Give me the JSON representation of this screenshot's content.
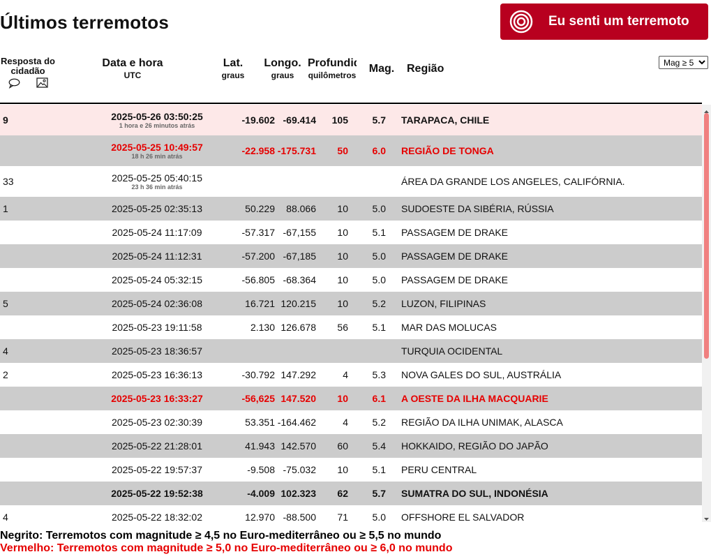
{
  "page": {
    "title": "Últimos terremotos"
  },
  "felt_button": {
    "label": "Eu senti um terremoto",
    "icon": "target-icon"
  },
  "header": {
    "response": "Resposta do cidadão",
    "date": "Data e hora",
    "date_sub": "UTC",
    "lat": "Lat.",
    "lat_sub": "graus",
    "lon": "Longo.",
    "lon_sub": "graus",
    "depth": "Profundid",
    "depth_sub": "quilômetros",
    "mag": "Mag.",
    "region": "Região"
  },
  "filter": {
    "selected": "Mag ≥ 5"
  },
  "rows": [
    {
      "resp": "9",
      "date": "2025-05-26 03:50:25",
      "ago": "1 hora e 26 minutos atrás",
      "lat": "-19.602",
      "lon": "-69.414",
      "depth": "105",
      "mag": "5.7",
      "region": "TARAPACA, CHILE",
      "style": "hl bold"
    },
    {
      "resp": "",
      "date": "2025-05-25 10:49:57",
      "ago": "18 h 26 min atrás",
      "lat": "-22.958",
      "lon": "-175.731",
      "depth": "50",
      "mag": "6.0",
      "region": "REGIÃO DE TONGA",
      "style": "alt red"
    },
    {
      "resp": "33",
      "date": "2025-05-25 05:40:15",
      "ago": "23 h 36 min atrás",
      "lat": "",
      "lon": "",
      "depth": "",
      "mag": "",
      "region": "ÁREA DA GRANDE LOS ANGELES, CALIFÓRNIA.",
      "style": ""
    },
    {
      "resp": "1",
      "date": "2025-05-25 02:35:13",
      "ago": "",
      "lat": "50.229",
      "lon": "88.066",
      "depth": "10",
      "mag": "5.0",
      "region": "SUDOESTE DA SIBÉRIA, RÚSSIA",
      "style": "alt"
    },
    {
      "resp": "",
      "date": "2025-05-24 11:17:09",
      "ago": "",
      "lat": "-57.317",
      "lon": "-67,155",
      "depth": "10",
      "mag": "5.1",
      "region": "PASSAGEM DE DRAKE",
      "style": ""
    },
    {
      "resp": "",
      "date": "2025-05-24 11:12:31",
      "ago": "",
      "lat": "-57.200",
      "lon": "-67,185",
      "depth": "10",
      "mag": "5.0",
      "region": "PASSAGEM DE DRAKE",
      "style": "alt"
    },
    {
      "resp": "",
      "date": "2025-05-24 05:32:15",
      "ago": "",
      "lat": "-56.805",
      "lon": "-68.364",
      "depth": "10",
      "mag": "5.0",
      "region": "PASSAGEM DE DRAKE",
      "style": ""
    },
    {
      "resp": "5",
      "date": "2025-05-24 02:36:08",
      "ago": "",
      "lat": "16.721",
      "lon": "120.215",
      "depth": "10",
      "mag": "5.2",
      "region": "LUZON, FILIPINAS",
      "style": "alt"
    },
    {
      "resp": "",
      "date": "2025-05-23 19:11:58",
      "ago": "",
      "lat": "2.130",
      "lon": "126.678",
      "depth": "56",
      "mag": "5.1",
      "region": "MAR DAS MOLUCAS",
      "style": ""
    },
    {
      "resp": "4",
      "date": "2025-05-23 18:36:57",
      "ago": "",
      "lat": "",
      "lon": "",
      "depth": "",
      "mag": "",
      "region": "TURQUIA OCIDENTAL",
      "style": "alt"
    },
    {
      "resp": "2",
      "date": "2025-05-23 16:36:13",
      "ago": "",
      "lat": "-30.792",
      "lon": "147.292",
      "depth": "4",
      "mag": "5.3",
      "region": "NOVA GALES DO SUL, AUSTRÁLIA",
      "style": ""
    },
    {
      "resp": "",
      "date": "2025-05-23 16:33:27",
      "ago": "",
      "lat": "-56,625",
      "lon": "147.520",
      "depth": "10",
      "mag": "6.1",
      "region": "A OESTE DA ILHA MACQUARIE",
      "style": "alt red"
    },
    {
      "resp": "",
      "date": "2025-05-23 02:30:39",
      "ago": "",
      "lat": "53.351",
      "lon": "-164.462",
      "depth": "4",
      "mag": "5.2",
      "region": "REGIÃO DA ILHA UNIMAK, ALASCA",
      "style": ""
    },
    {
      "resp": "",
      "date": "2025-05-22 21:28:01",
      "ago": "",
      "lat": "41.943",
      "lon": "142.570",
      "depth": "60",
      "mag": "5.4",
      "region": "HOKKAIDO, REGIÃO DO JAPÃO",
      "style": "alt"
    },
    {
      "resp": "",
      "date": "2025-05-22 19:57:37",
      "ago": "",
      "lat": "-9.508",
      "lon": "-75.032",
      "depth": "10",
      "mag": "5.1",
      "region": "PERU CENTRAL",
      "style": ""
    },
    {
      "resp": "",
      "date": "2025-05-22 19:52:38",
      "ago": "",
      "lat": "-4.009",
      "lon": "102.323",
      "depth": "62",
      "mag": "5.7",
      "region": "SUMATRA DO SUL, INDONÉSIA",
      "style": "alt bold"
    },
    {
      "resp": "4",
      "date": "2025-05-22 18:32:02",
      "ago": "",
      "lat": "12.970",
      "lon": "-88.500",
      "depth": "71",
      "mag": "5.0",
      "region": "OFFSHORE EL SALVADOR",
      "style": ""
    }
  ],
  "legend": {
    "bold": "Negrito: Terremotos com magnitude ≥ 4,5 no Euro-mediterrâneo ou ≥ 5,5 no mundo",
    "red": "Vermelho: Terremotos com magnitude ≥ 5,0 no Euro-mediterrâneo ou ≥ 6,0 no mundo"
  },
  "colors": {
    "accent": "#b8001f",
    "alt_row": "#cccccc",
    "highlight_row": "#fde8e8",
    "red_text": "#e60000",
    "scroll_thumb": "#f08080"
  }
}
